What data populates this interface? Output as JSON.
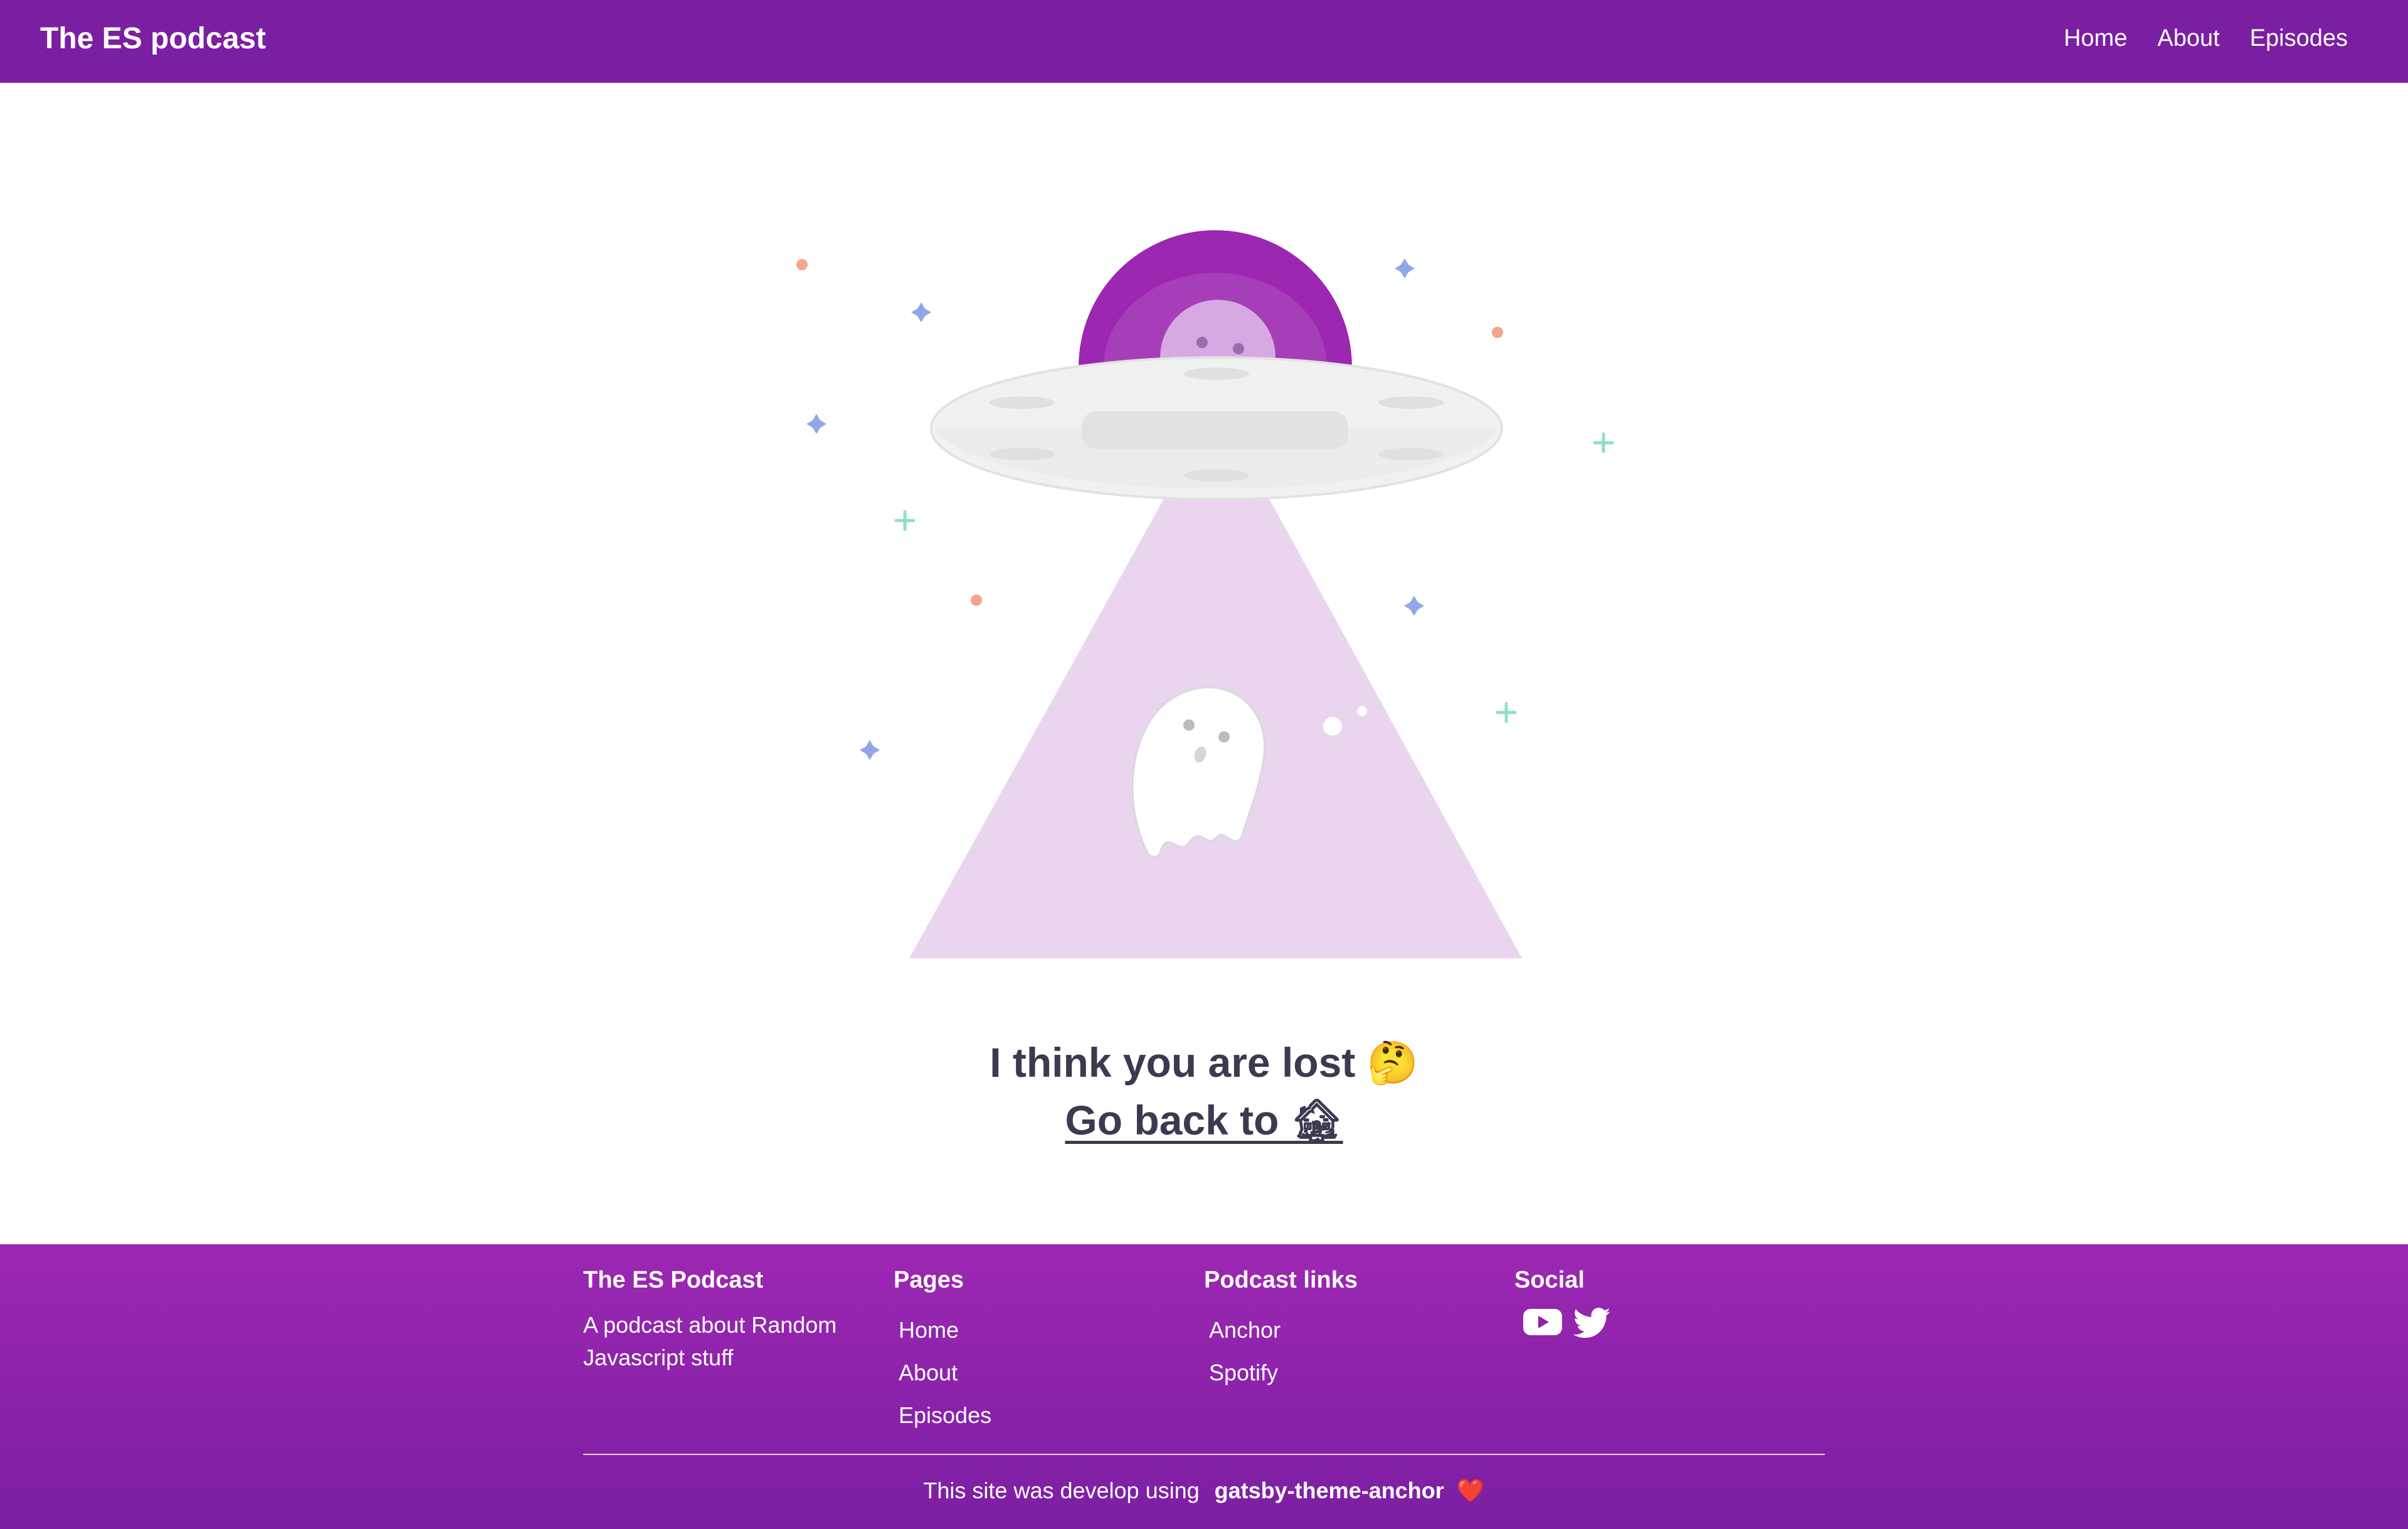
{
  "header": {
    "brand": "The ES podcast",
    "nav": [
      "Home",
      "About",
      "Episodes"
    ]
  },
  "main": {
    "lost_text": "I think you are lost 🤔",
    "go_back_text": "Go back to 🏚"
  },
  "footer": {
    "col1": {
      "title": "The ES Podcast",
      "description": "A podcast about Random Javascript stuff"
    },
    "col2": {
      "title": "Pages",
      "items": [
        "Home",
        "About",
        "Episodes"
      ]
    },
    "col3": {
      "title": "Podcast links",
      "items": [
        "Anchor",
        "Spotify"
      ]
    },
    "col4": {
      "title": "Social",
      "icons": [
        "youtube-icon",
        "twitter-icon"
      ]
    },
    "credit_prefix": "This site was develop using",
    "credit_link": "gatsby-theme-anchor",
    "credit_suffix": "❤️"
  },
  "colors": {
    "header_bg": "#7b1fa2",
    "footer_top": "#9d27b3",
    "footer_bottom": "#7b1fa2",
    "text_dark": "#3c3950",
    "beam": "#ead5ef"
  }
}
